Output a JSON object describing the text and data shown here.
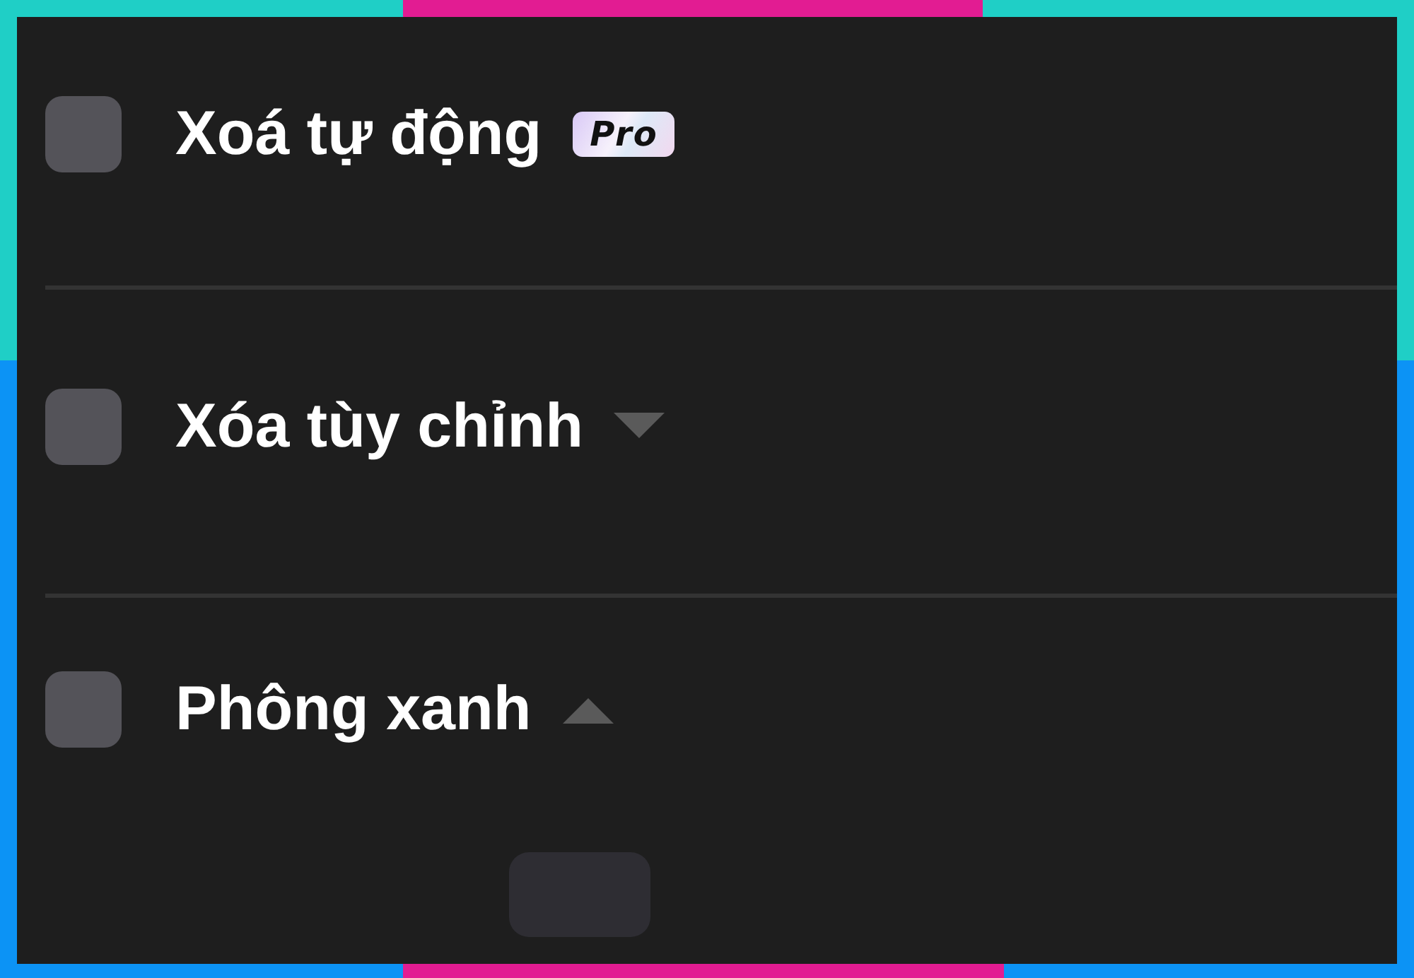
{
  "options": [
    {
      "label": "Xoá tự động",
      "checked": false,
      "badge": "Pro"
    },
    {
      "label": "Xóa tùy chỉnh",
      "checked": false,
      "expanded": false
    },
    {
      "label": "Phông xanh",
      "checked": false,
      "expanded": true
    }
  ]
}
